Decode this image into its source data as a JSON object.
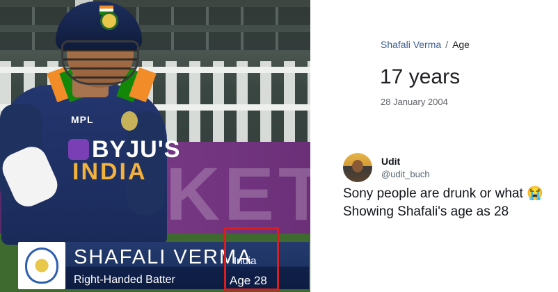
{
  "photo": {
    "board_text": "KET",
    "jersey": {
      "sponsor_top": "MPL",
      "sponsor_main": "BYJU'S",
      "team": "INDIA"
    },
    "lower_third": {
      "player_name": "SHAFALI VERMA",
      "role": "Right-Handed Batter",
      "country": "India",
      "age": "Age 28"
    },
    "highlight_color": "#d81f1f"
  },
  "search_card": {
    "breadcrumb_name": "Shafali Verma",
    "breadcrumb_separator": "/",
    "breadcrumb_current": "Age",
    "age_value": "17 years",
    "date_of_birth": "28 January 2004"
  },
  "tweet": {
    "display_name": "Udit",
    "handle": "@udit_buch",
    "text": "Sony people are drunk or what 😭 Showing Shafali's age as 28"
  }
}
